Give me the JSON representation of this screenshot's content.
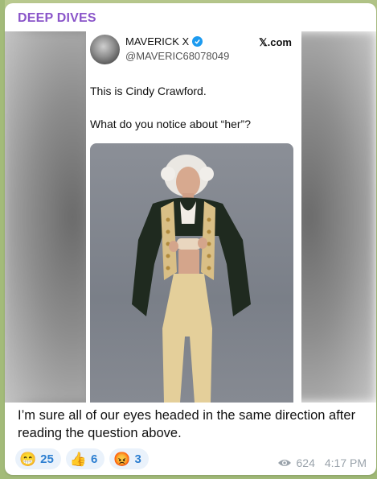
{
  "channel": {
    "name": "DEEP DIVES"
  },
  "tweet": {
    "display_name": "MAVERICK X",
    "handle": "@MAVERIC68078049",
    "site": "𝕏.com",
    "text_line1": "This is Cindy Crawford.",
    "text_line2": "What do you notice about “her”?"
  },
  "message": {
    "caption": "I’m sure all of our eyes headed in the same direction after reading the question above."
  },
  "reactions": [
    {
      "emoji": "😁",
      "count": "25"
    },
    {
      "emoji": "👍",
      "count": "6"
    },
    {
      "emoji": "😡",
      "count": "3"
    }
  ],
  "meta": {
    "views": "624",
    "time": "4:17 PM"
  },
  "colors": {
    "channel": "#8a55c9",
    "reaction_text": "#2d7fd1",
    "verified": "#1d9bf0"
  }
}
